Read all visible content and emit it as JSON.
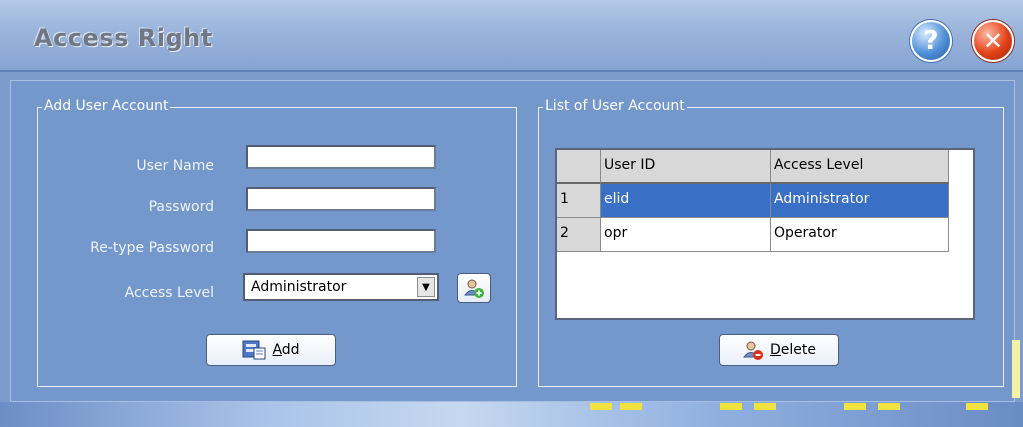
{
  "window": {
    "title": "Access Right"
  },
  "header_buttons": {
    "help_glyph": "?",
    "close_glyph": "✕"
  },
  "add_group": {
    "legend": "Add User Account",
    "user_name_label": "User Name",
    "password_label": "Password",
    "retype_label": "Re-type Password",
    "access_level_label": "Access Level",
    "user_name_value": "",
    "password_value": "",
    "retype_value": "",
    "access_level_selected": "Administrator",
    "add_button_label_hotkey": "A",
    "add_button_label_rest": "dd"
  },
  "list_group": {
    "legend": "List of User Account",
    "columns": [
      "",
      "User ID",
      "Access Level"
    ],
    "rows": [
      {
        "index": "1",
        "user_id": "elid",
        "access_level": "Administrator",
        "selected": true
      },
      {
        "index": "2",
        "user_id": "opr",
        "access_level": "Operator",
        "selected": false
      }
    ],
    "delete_button_label_hotkey": "D",
    "delete_button_label_rest": "elete"
  },
  "colors": {
    "panel_bg": "#7498cc",
    "selected_row": "#3a6fc6",
    "close_red": "#e34218",
    "help_blue": "#4d8fd6"
  },
  "icons": [
    "help-icon",
    "close-icon",
    "dropdown-arrow-icon",
    "add-user-icon",
    "add-record-icon",
    "delete-user-icon"
  ]
}
